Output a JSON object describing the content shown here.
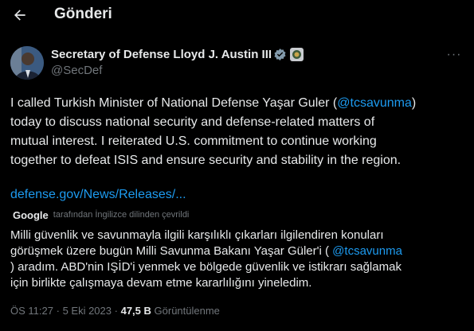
{
  "header": {
    "title": "Gönderi",
    "back_icon": "arrow-left-icon"
  },
  "author": {
    "name": "Secretary of Defense Lloyd J. Austin III",
    "handle": "@SecDef",
    "verified_icon": "verified-badge-icon",
    "affiliation_icon": "government-affiliation-icon",
    "more_icon": "more-options-icon",
    "more_label": "···"
  },
  "tweet": {
    "line1_pre": "I called Turkish Minister of National Defense Yaşar Guler (",
    "mention": "@tcsavunma",
    "line1_post": ")",
    "line2": "today to discuss national security and defense-related matters of",
    "line3": "mutual interest. I reiterated U.S. commitment to continue working",
    "line4": "together to defeat ISIS and ensure security and stability in the region."
  },
  "link": {
    "text": "defense.gov/News/Releases/..."
  },
  "translation": {
    "provider": "Google",
    "note": "tarafından İngilizce dilinden çevrildi",
    "line1": "Milli güvenlik ve savunmayla ilgili karşılıklı çıkarları ilgilendiren konuları",
    "line2_pre": "görüşmek üzere bugün Milli Savunma Bakanı Yaşar Güler'i ( ",
    "mention": "@tcsavunma",
    "line3": ") aradım. ABD'nin IŞİD'i yenmek ve bölgede güvenlik ve istikrarı sağlamak",
    "line4": "için birlikte çalışmaya devam etme kararlılığını yineledim."
  },
  "meta": {
    "time": "ÖS 11:27",
    "separator": "·",
    "date": "5 Eki 2023",
    "views_count": "47,5 B",
    "views_label": "Görüntülenme"
  },
  "colors": {
    "background": "#000000",
    "text": "#e7e9ea",
    "secondary": "#71767b",
    "accent": "#1d9bf0"
  }
}
